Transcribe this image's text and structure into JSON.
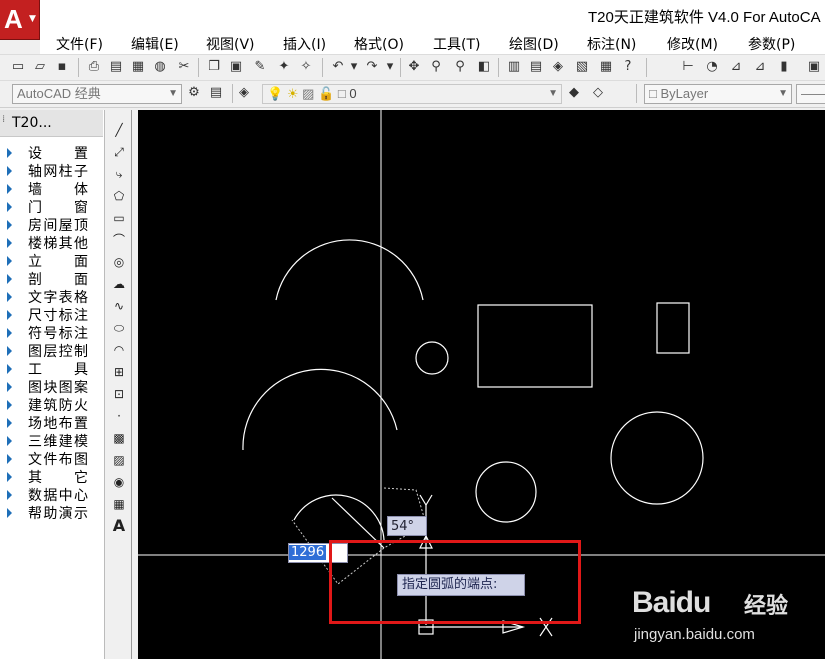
{
  "app": {
    "title": "T20天正建筑软件 V4.0 For AutoCA",
    "logo_letter": "A"
  },
  "menu": [
    "文件(F)",
    "编辑(E)",
    "视图(V)",
    "插入(I)",
    "格式(O)",
    "工具(T)",
    "绘图(D)",
    "标注(N)",
    "修改(M)",
    "参数(P)"
  ],
  "toolbar2": {
    "workspace": "AutoCAD 经典",
    "layer_value": "0",
    "linetype": "ByLayer"
  },
  "palette": {
    "title": "T20...",
    "items": [
      "设置",
      "轴网柱子",
      "墙体",
      "门窗",
      "房间屋顶",
      "楼梯其他",
      "立面",
      "剖面",
      "文字表格",
      "尺寸标注",
      "符号标注",
      "图层控制",
      "工具",
      "图块图案",
      "建筑防火",
      "场地布置",
      "三维建模",
      "文件布图",
      "其它",
      "数据中心",
      "帮助演示"
    ]
  },
  "drawbar": {
    "icons": [
      "line-icon",
      "construction-line-icon",
      "polyline-icon",
      "polygon-icon",
      "rectangle-icon",
      "arc-icon",
      "circle-icon",
      "revcloud-icon",
      "spline-icon",
      "ellipse-icon",
      "ellipse-arc-icon",
      "insert-block-icon",
      "make-block-icon",
      "point-icon",
      "hatch-icon",
      "gradient-icon",
      "region-icon",
      "table-icon",
      "multiline-text-icon"
    ],
    "text_tool": "A"
  },
  "command": {
    "angle": "54°",
    "length_input": "1296",
    "prompt": "指定圆弧的端点:"
  },
  "watermark": {
    "brand": "Baidu",
    "jingyan": "经验",
    "url": "jingyan.baidu.com"
  },
  "colors": {
    "canvas_bg": "#000000",
    "highlight": "#e01818",
    "app_button": "#c32020"
  }
}
